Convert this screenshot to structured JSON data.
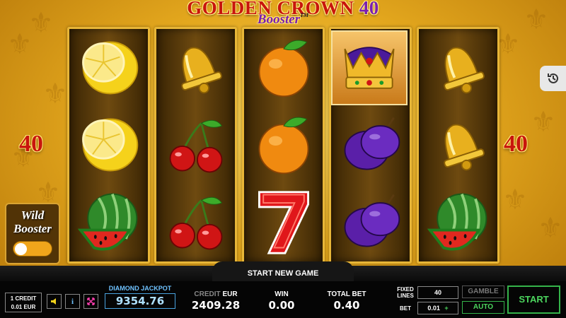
{
  "game": {
    "title_main": "GOLDEN CROWN",
    "title_number": "40",
    "subtitle": "Booster",
    "trademark": "TM"
  },
  "lines_left": "40",
  "lines_right": "40",
  "reels": [
    [
      "lemon",
      "lemon",
      "watermelon"
    ],
    [
      "bell",
      "cherries",
      "cherries"
    ],
    [
      "orange",
      "orange",
      "seven"
    ],
    [
      "crown",
      "plum",
      "plum"
    ],
    [
      "bell",
      "bell",
      "watermelon"
    ]
  ],
  "highlighted_cell": {
    "reel": 4,
    "row": 1
  },
  "wild_booster": {
    "title_line1": "Wild",
    "title_line2": "Booster",
    "toggle_on": false
  },
  "history_icon": "history-icon",
  "status_text": "START NEW GAME",
  "bottom": {
    "credit_line1": "1 CREDIT",
    "credit_line2": "0.01 EUR",
    "sound_icon": "speaker-icon",
    "info_icon": "info-icon",
    "fullscreen_icon": "fullscreen-icon",
    "jackpot_label": "DIAMOND JACKPOT",
    "jackpot_value": "9354.76",
    "credit_label": "CREDIT",
    "credit_currency": "EUR",
    "credit_value": "2409.28",
    "win_label": "WIN",
    "win_value": "0.00",
    "total_bet_label": "TOTAL BET",
    "total_bet_value": "0.40",
    "fixed_lines_label_1": "FIXED",
    "fixed_lines_label_2": "LINES",
    "fixed_lines_value": "40",
    "bet_label": "BET",
    "bet_value": "0.01",
    "bet_stepper_icon": "plus-icon",
    "gamble_label": "GAMBLE",
    "auto_label": "AUTO",
    "start_label": "START"
  },
  "colors": {
    "title_red": "#c8150d",
    "title_purple": "#7a1fb0",
    "reel_border": "#e8b637",
    "start_green": "#4cd65e",
    "jackpot_blue": "#6fc2ff"
  }
}
